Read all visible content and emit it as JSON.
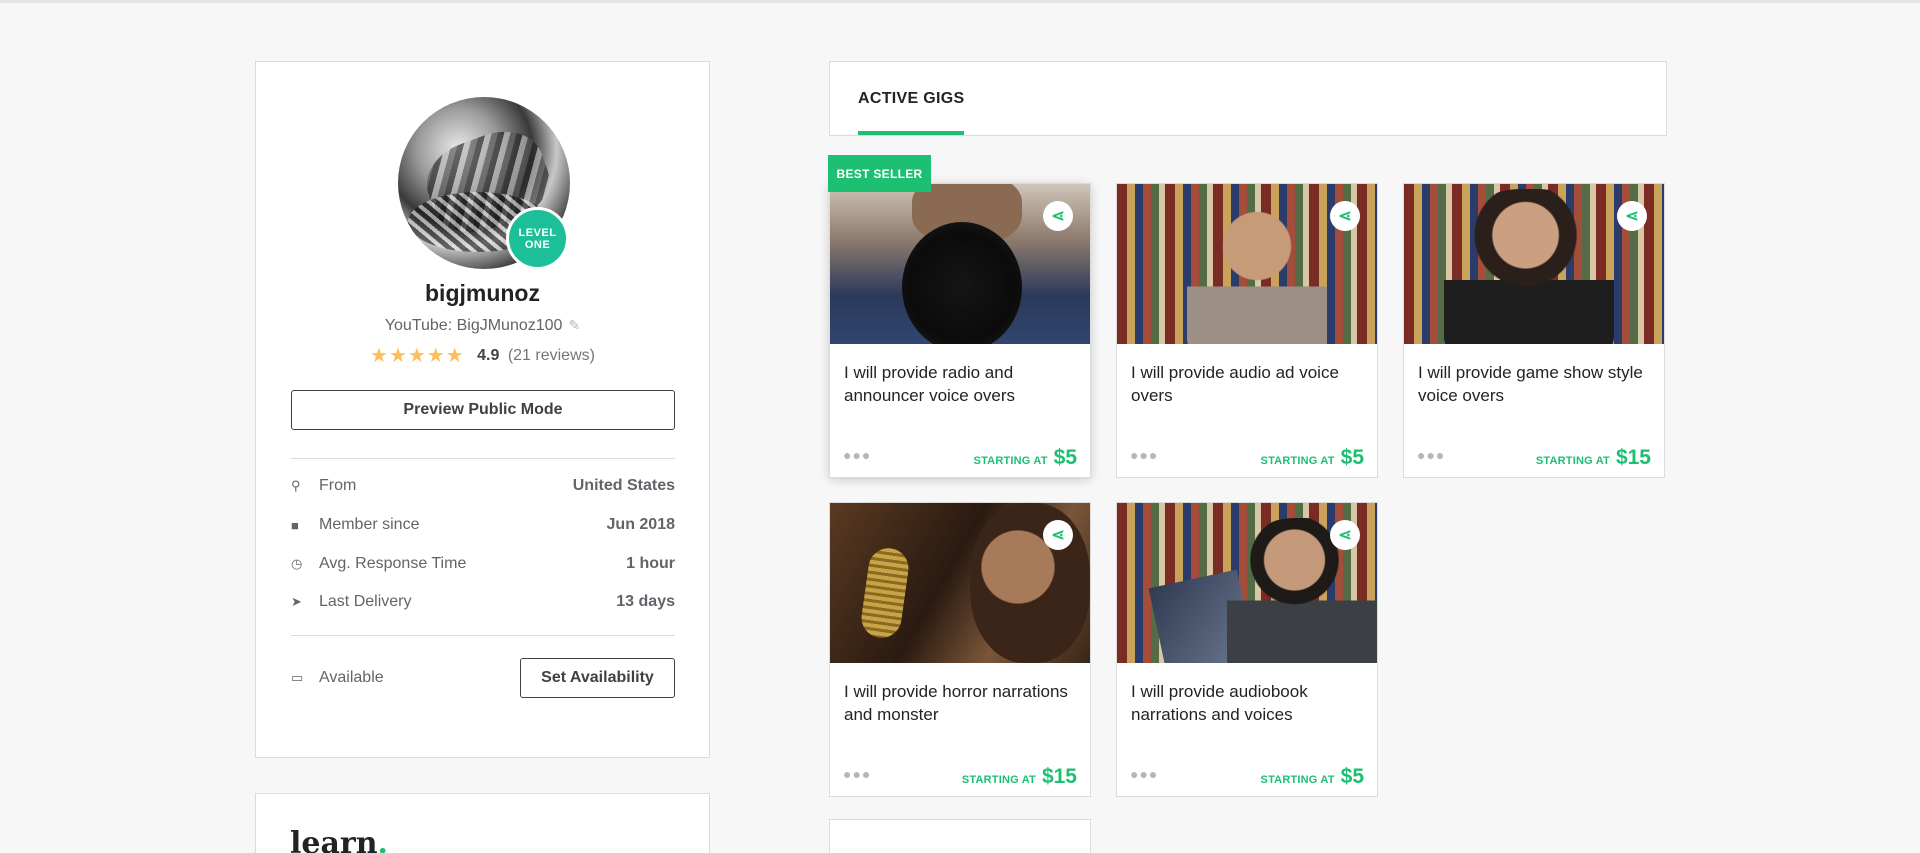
{
  "profile": {
    "level_badge_line1": "LEVEL",
    "level_badge_line2": "ONE",
    "username": "bigjmunoz",
    "tagline": "YouTube: BigJMunoz100",
    "rating_stars": "★★★★★",
    "rating_score": "4.9",
    "rating_count": "(21 reviews)",
    "preview_button": "Preview Public Mode",
    "stats": [
      {
        "icon": "location-pin-icon",
        "glyph": "⚲",
        "label": "From",
        "value": "United States"
      },
      {
        "icon": "user-icon",
        "glyph": "👤",
        "label": "Member since",
        "value": "Jun 2018"
      },
      {
        "icon": "clock-icon",
        "glyph": "◷",
        "label": "Avg. Response Time",
        "value": "1 hour"
      },
      {
        "icon": "paper-plane-icon",
        "glyph": "➤",
        "label": "Last Delivery",
        "value": "13 days"
      }
    ],
    "availability_label": "Available",
    "availability_icon": "calendar-icon",
    "set_availability_button": "Set Availability"
  },
  "learn": {
    "logo_text": "learn",
    "logo_dot": "."
  },
  "gigs_section": {
    "tab_label": "ACTIVE GIGS"
  },
  "badges": {
    "best_seller": "BEST SELLER"
  },
  "gigs": [
    {
      "title": "I will provide radio and announcer voice overs",
      "price_label": "STARTING AT",
      "price": "$5"
    },
    {
      "title": "I will provide audio ad voice overs",
      "price_label": "STARTING AT",
      "price": "$5"
    },
    {
      "title": "I will provide game show style voice overs",
      "price_label": "STARTING AT",
      "price": "$15"
    },
    {
      "title": "I will provide horror narrations and monster",
      "price_label": "STARTING AT",
      "price": "$15"
    },
    {
      "title": "I will provide audiobook narrations and voices",
      "price_label": "STARTING AT",
      "price": "$5"
    }
  ],
  "colors": {
    "accent_green": "#1dbf73",
    "level_badge": "#1dbf98",
    "star": "#ffbe5b",
    "background": "#f7f7f7"
  }
}
